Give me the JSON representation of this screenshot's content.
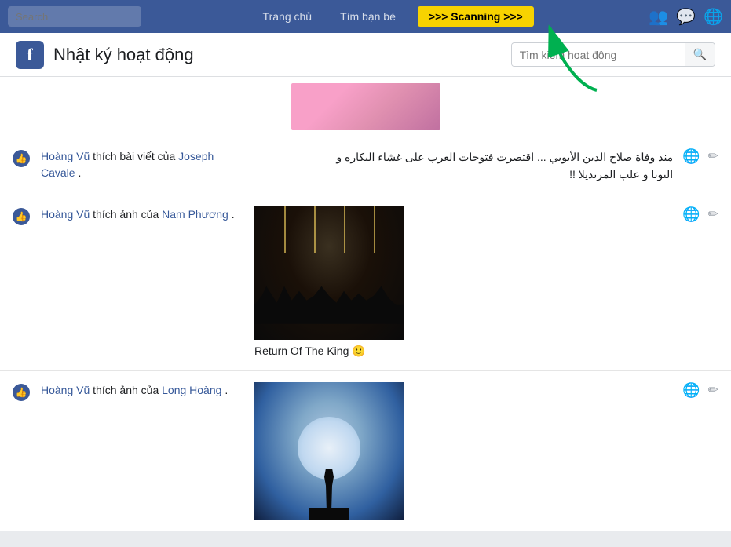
{
  "nav": {
    "search_placeholder": "Search",
    "links": [
      {
        "label": "Trang chủ",
        "id": "home"
      },
      {
        "label": "Tìm bạn bè",
        "id": "find-friends"
      }
    ],
    "scanning_label": ">>> Scanning >>>",
    "icons": {
      "friends": "👥",
      "messages": "💬",
      "globe": "🌐"
    }
  },
  "header": {
    "logo": "f",
    "title": "Nhật ký hoạt động",
    "search_placeholder": "Tìm kiếm hoạt động",
    "search_btn": "🔍"
  },
  "activities": [
    {
      "id": 1,
      "user": "Hoàng Vũ",
      "action": "thích bài viết của",
      "target": "Joseph Cavale",
      "target2": null,
      "text": "منذ وفاة صلاح الدين الأيوبي ... اقتصرت فتوحات العرب على غشاء البكاره و",
      "text2": "التونا و علب المرتديلا !!",
      "has_image": false,
      "image_caption": null
    },
    {
      "id": 2,
      "user": "Hoàng Vũ",
      "action": "thích ảnh của",
      "target": "Nam Phương",
      "text": null,
      "has_image": true,
      "image_type": "concert",
      "image_caption": "Return Of The King 🙂"
    },
    {
      "id": 3,
      "user": "Hoàng Vũ",
      "action": "thích ảnh của",
      "target": "Long Hoàng",
      "text": null,
      "has_image": true,
      "image_type": "ninja",
      "image_caption": null
    }
  ]
}
